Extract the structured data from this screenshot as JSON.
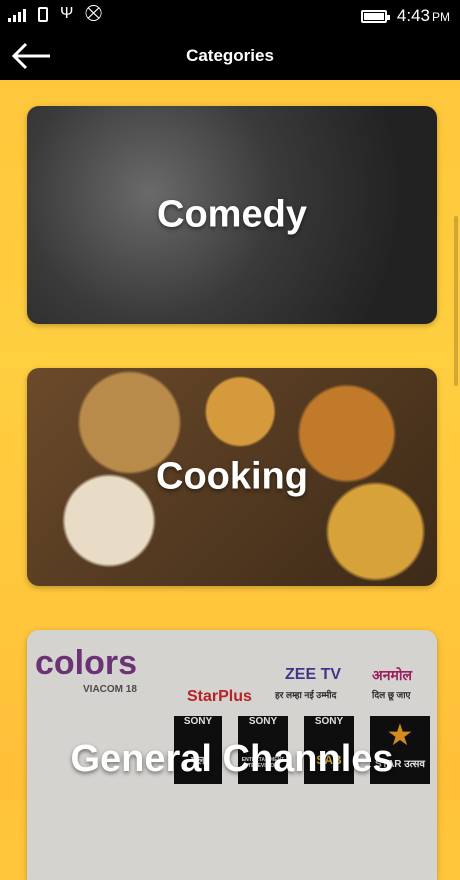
{
  "status_bar": {
    "time": "4:43",
    "ampm": "PM",
    "icons": [
      "signal-icon",
      "sim-icon",
      "usb-icon",
      "no-data-icon",
      "battery-icon"
    ]
  },
  "app_bar": {
    "title": "Categories",
    "back_icon": "arrow-left-icon"
  },
  "categories": [
    {
      "label": "Comedy"
    },
    {
      "label": "Cooking"
    },
    {
      "label": "General Channles"
    }
  ],
  "channel_logos": [
    "colors",
    "VIACOM 18",
    "StarPlus",
    "ZEE TV",
    "हर लम्हा नई उम्मीद",
    "अनमोल",
    "दिल छू जाए",
    "SONY",
    "पल",
    "SONY",
    "ENTERTAINMENT TELEVISION",
    "SONY",
    "SAB",
    "STAR उत्सव"
  ],
  "colors": {
    "background": "#ffc43a",
    "bars": "#000000"
  }
}
